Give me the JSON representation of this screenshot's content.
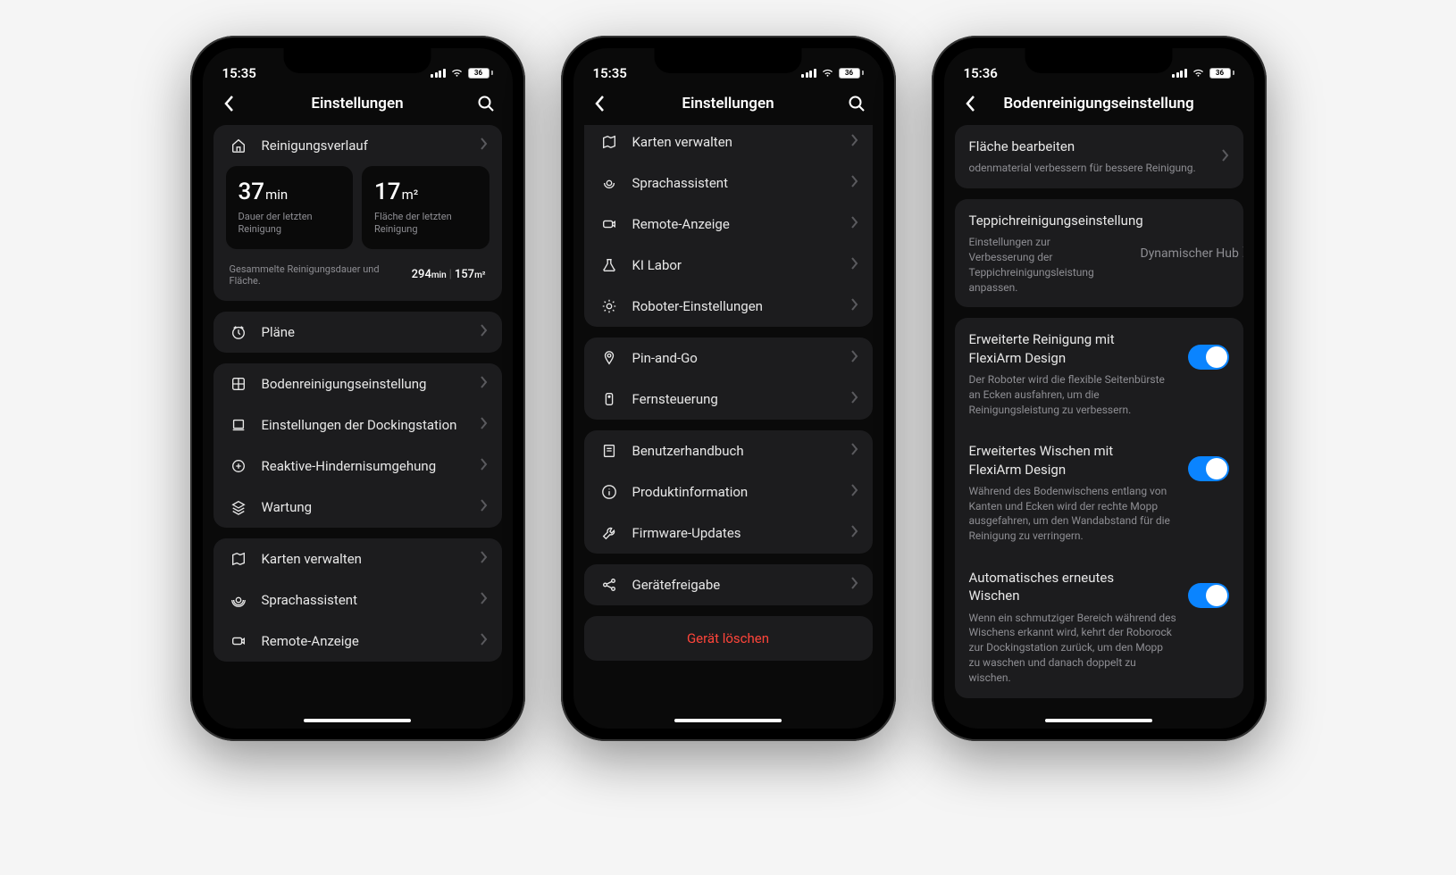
{
  "status": {
    "time1": "15:35",
    "time2": "15:35",
    "time3": "15:36",
    "battery": "36"
  },
  "screen1": {
    "title": "Einstellungen",
    "history_label": "Reinigungsverlauf",
    "stat1_val": "37",
    "stat1_unit": "min",
    "stat1_label": "Dauer der letzten Reinigung",
    "stat2_val": "17",
    "stat2_unit": "m²",
    "stat2_label": "Fläche der letzten Reinigung",
    "totals_label": "Gesammelte Reinigungsdauer und Fläche.",
    "totals_min": "294",
    "totals_min_unit": "min",
    "totals_area": "157",
    "totals_area_unit": "m²",
    "plans": "Pläne",
    "items_a": [
      "Bodenreinigungseinstellung",
      "Einstellungen der Dockingstation",
      "Reaktive-Hindernisumgehung",
      "Wartung"
    ],
    "items_b": [
      "Karten verwalten",
      "Sprachassistent",
      "Remote-Anzeige"
    ]
  },
  "screen2": {
    "title": "Einstellungen",
    "group1": [
      "Karten verwalten",
      "Sprachassistent",
      "Remote-Anzeige",
      "KI Labor",
      "Roboter-Einstellungen"
    ],
    "group2": [
      "Pin-and-Go",
      "Fernsteuerung"
    ],
    "group3": [
      "Benutzerhandbuch",
      "Produktinformation",
      "Firmware-Updates"
    ],
    "group4": [
      "Gerätefreigabe"
    ],
    "delete": "Gerät löschen"
  },
  "screen3": {
    "title": "Bodenreinigungseinstellung",
    "s1_title": "Fläche bearbeiten",
    "s1_desc": "odenmaterial verbessern für bessere Reinigung.",
    "s2_title": "Teppichreinigungseinstellung",
    "s2_desc": "Einstellungen zur Verbesserung der Teppichreinigungsleistung anpassen.",
    "s2_value": "Dynamischer Hub",
    "s3_title": "Erweiterte Reinigung mit FlexiArm Design",
    "s3_desc": "Der Roboter wird die flexible Seitenbürste an Ecken ausfahren, um die Reinigungsleistung zu verbessern.",
    "s4_title": "Erweitertes Wischen mit FlexiArm Design",
    "s4_desc": "Während des Bodenwischens entlang von Kanten und Ecken wird der rechte Mopp ausgefahren, um den Wandabstand für die Reinigung zu verringern.",
    "s5_title": "Automatisches erneutes Wischen",
    "s5_desc": "Wenn ein schmutziger Bereich während des Wischens erkannt wird, kehrt der Roborock zur Dockingstation zurück, um den Mopp zu waschen und danach doppelt zu wischen."
  }
}
